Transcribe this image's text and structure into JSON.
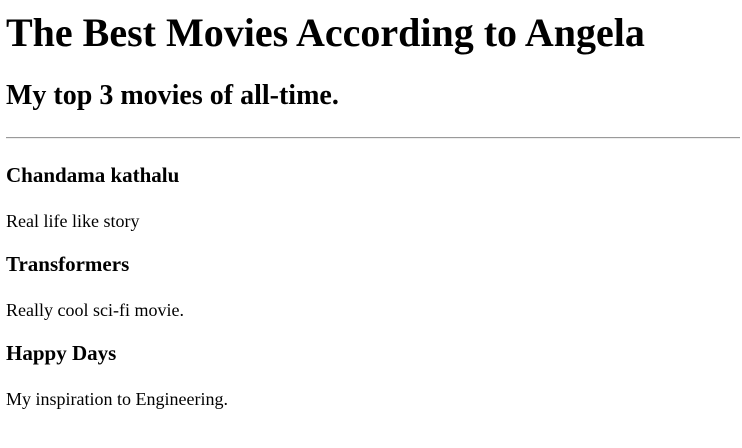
{
  "page": {
    "title": "The Best Movies According to Angela",
    "subtitle": "My top 3 movies of all-time."
  },
  "movies": [
    {
      "title": "Chandama kathalu",
      "description": "Real life like story"
    },
    {
      "title": "Transformers",
      "description": "Really cool sci-fi movie."
    },
    {
      "title": "Happy Days",
      "description": "My inspiration to Engineering."
    }
  ]
}
